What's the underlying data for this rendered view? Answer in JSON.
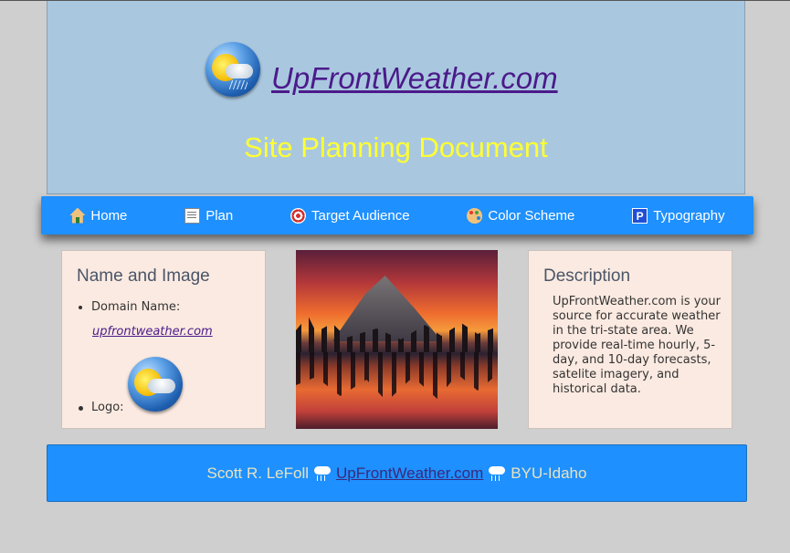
{
  "header": {
    "logo_icon": "weather-globe-icon",
    "site_link": "UpFrontWeather.com",
    "subtitle": "Site Planning Document"
  },
  "nav": {
    "items": [
      {
        "label": "Home",
        "icon": "home-icon"
      },
      {
        "label": "Plan",
        "icon": "notepad-icon"
      },
      {
        "label": "Target Audience",
        "icon": "target-icon"
      },
      {
        "label": "Color Scheme",
        "icon": "palette-icon"
      },
      {
        "label": "Typography",
        "icon": "p-square-icon"
      }
    ]
  },
  "card_left": {
    "title": "Name and Image",
    "domain_label": "Domain Name:",
    "domain_link": "upfrontweather.com",
    "logo_label": "Logo:"
  },
  "card_right": {
    "title": "Description",
    "text": "UpFrontWeather.com is your source for accurate weather in the tri-state area. We provide real-time hourly, 5-day, and 10-day forecasts, satelite imagery, and historical data."
  },
  "footer": {
    "author": "Scott R. LeFoll",
    "link": "UpFrontWeather.com",
    "school": "BYU-Idaho",
    "separator_icon": "rain-cloud-icon"
  },
  "colors": {
    "background": "#cfcfcf",
    "header_bg": "#a9c8df",
    "nav_bg": "#1e90ff",
    "subtitle": "#ffff33",
    "card_bg": "#fbeae1",
    "link": "#4b1a8a"
  }
}
